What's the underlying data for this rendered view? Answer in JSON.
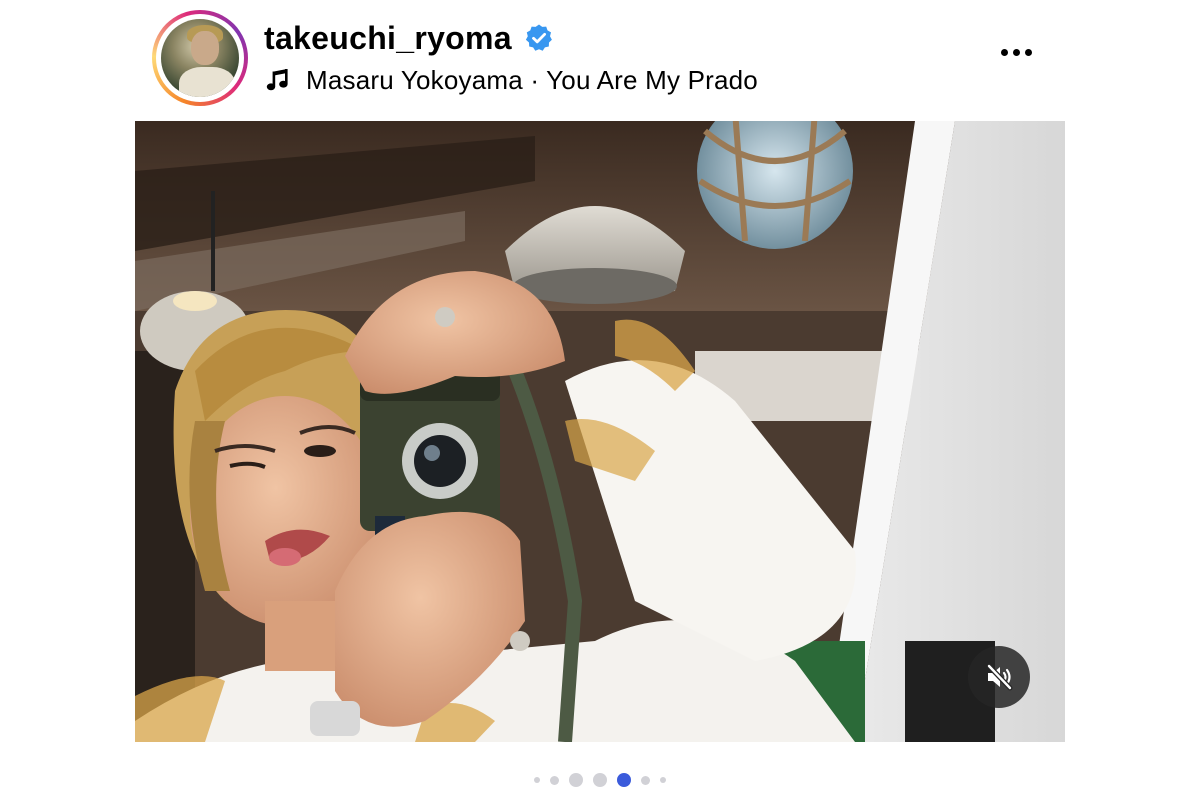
{
  "post": {
    "username": "takeuchi_ryoma",
    "verified": true,
    "music": {
      "artist": "Masaru Yokoyama",
      "separator": "·",
      "track": "You Are My Prado",
      "label": "Masaru Yokoyama · You Are My Prado"
    },
    "icons": {
      "verified": "verified-badge-icon",
      "music": "music-note-icon",
      "more": "more-options-icon",
      "mute": "sound-off-icon"
    },
    "colors": {
      "verified_badge": "#3897f0",
      "active_dot": "#3b5bdb",
      "inactive_dot": "#d1d1d6",
      "story_ring": [
        "#f58529",
        "#feda77",
        "#dd2a7b",
        "#8134af"
      ]
    },
    "media": {
      "type": "photo",
      "audio_muted": true
    },
    "carousel": {
      "total_indicators": 7,
      "active_index": 4
    }
  }
}
